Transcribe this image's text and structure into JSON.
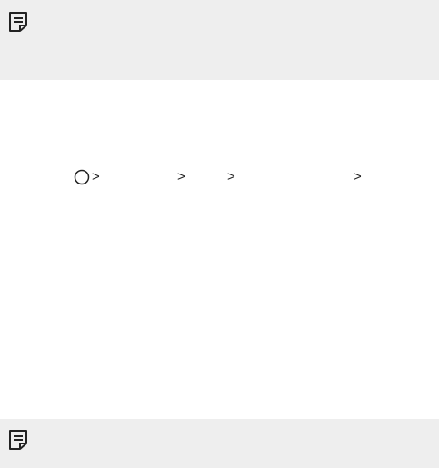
{
  "icons": {
    "top_note": "note-icon",
    "bottom_note": "note-icon",
    "home": "home-circle-icon",
    "separator": "chevron-right-icon"
  },
  "path": {
    "separators": [
      ">",
      ">",
      ">",
      ">"
    ]
  },
  "colors": {
    "note_background": "#eeeeee",
    "text": "#222222"
  }
}
